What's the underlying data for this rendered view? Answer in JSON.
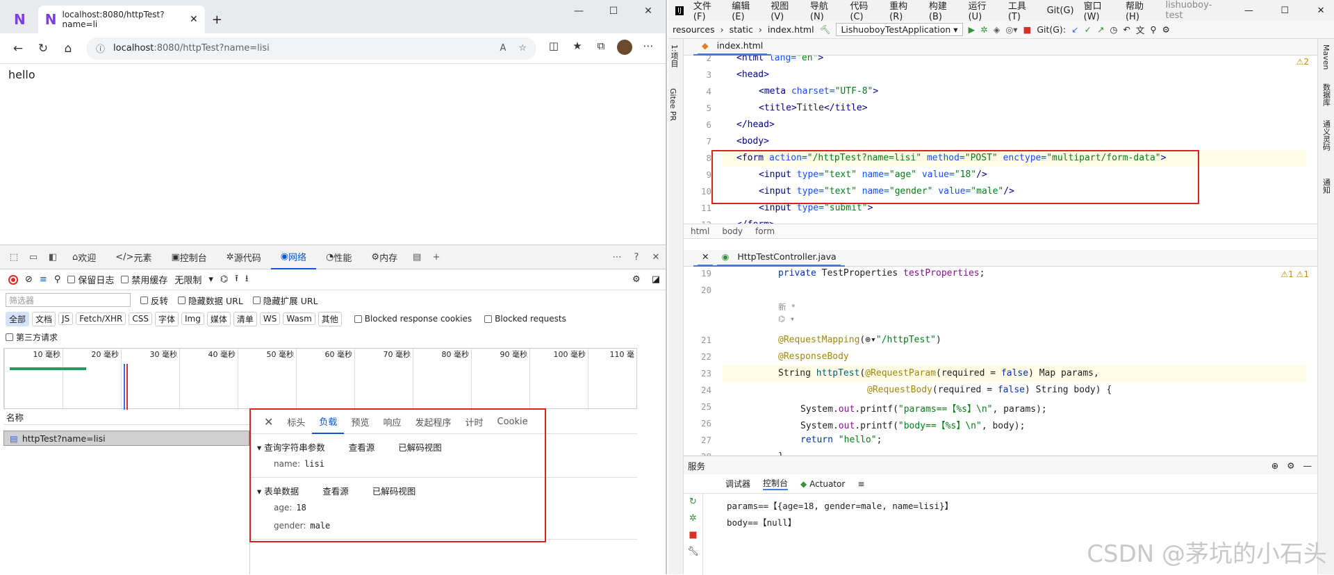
{
  "browser": {
    "tab_title": "localhost:8080/httpTest?name=li",
    "url_host": "localhost",
    "url_rest": ":8080/httpTest?name=lisi",
    "page_text": "hello",
    "devtools_tabs": [
      "欢迎",
      "元素",
      "控制台",
      "源代码",
      "网络",
      "性能",
      "内存"
    ],
    "toolbar": {
      "preserve_log": "保留日志",
      "disable_cache": "禁用缓存",
      "throttle": "无限制"
    },
    "filter": {
      "placeholder": "筛选器",
      "invert": "反转",
      "hide_data_urls": "隐藏数据 URL",
      "hide_ext_urls": "隐藏扩展 URL"
    },
    "types": [
      "全部",
      "文档",
      "JS",
      "Fetch/XHR",
      "CSS",
      "字体",
      "Img",
      "媒体",
      "清单",
      "WS",
      "Wasm",
      "其他"
    ],
    "blocked_cookies": "Blocked response cookies",
    "blocked_requests": "Blocked requests",
    "third_party": "第三方请求",
    "ticks": [
      "10 毫秒",
      "20 毫秒",
      "30 毫秒",
      "40 毫秒",
      "50 毫秒",
      "60 毫秒",
      "70 毫秒",
      "80 毫秒",
      "90 毫秒",
      "100 毫秒",
      "110 毫"
    ],
    "name_col": "名称",
    "request_name": "httpTest?name=lisi",
    "detail_tabs": [
      "标头",
      "负载",
      "预览",
      "响应",
      "发起程序",
      "计时",
      "Cookie"
    ],
    "query": {
      "title": "查询字符串参数",
      "view_source": "查看源",
      "decoded": "已解码视图",
      "key": "name:",
      "value": "lisi"
    },
    "form": {
      "title": "表单数据",
      "view_source": "查看源",
      "decoded": "已解码视图",
      "items": [
        {
          "key": "age:",
          "value": "18"
        },
        {
          "key": "gender:",
          "value": "male"
        }
      ]
    }
  },
  "ide": {
    "menu": [
      "文件(F)",
      "编辑(E)",
      "视图(V)",
      "导航(N)",
      "代码(C)",
      "重构(R)",
      "构建(B)",
      "运行(U)",
      "工具(T)",
      "Git(G)",
      "窗口(W)",
      "帮助(H)",
      "lishuoboy-test"
    ],
    "path": [
      "resources",
      "static",
      "index.html"
    ],
    "run_config": "LishuoboyTestApplication",
    "git_label": "Git(G):",
    "editor1_tab": "index.html",
    "editor1_lines": [
      "2",
      "3",
      "4",
      "5",
      "6",
      "7",
      "8",
      "9",
      "10",
      "11",
      "12"
    ],
    "warn1": "⚠2",
    "breadcrumb": [
      "html",
      "body",
      "form"
    ],
    "editor2_tab": "HttpTestController.java",
    "editor2_lines": [
      "19",
      "20",
      "",
      "",
      "21",
      "22",
      "23",
      "24",
      "25",
      "26",
      "27",
      "28"
    ],
    "warn2": "⚠1  ⚠1",
    "services_title": "服务",
    "svc_tabs": [
      "调试器",
      "控制台",
      "Actuator"
    ],
    "console_lines": [
      "params==【{age=18, gender=male, name=lisi}】",
      "body==【null】"
    ],
    "left_tool": [
      "1:项目",
      "Gitee PR"
    ],
    "right_tool": [
      "Maven",
      "数据库",
      "通义灵码",
      "通知"
    ],
    "watermark": "CSDN @茅坑的小石头"
  }
}
